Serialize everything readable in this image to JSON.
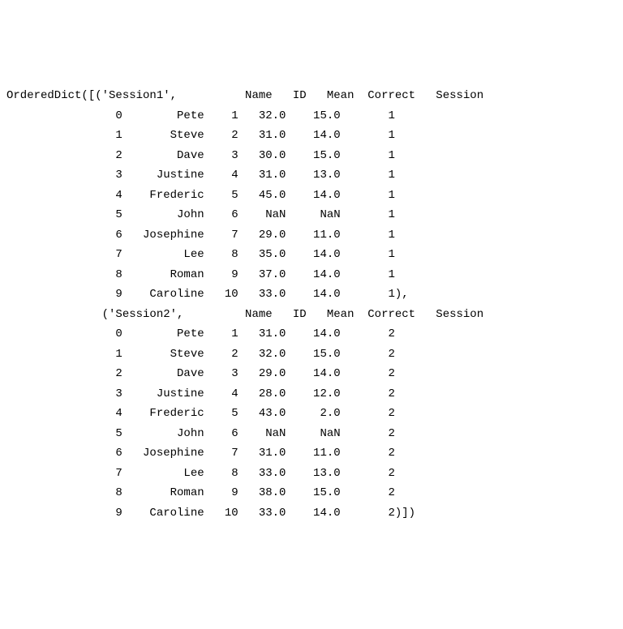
{
  "prefix": "OrderedDict([",
  "sessions": [
    {
      "key": "'Session1'",
      "columns": [
        "Name",
        "ID",
        "Mean",
        "Correct",
        "Session"
      ],
      "rows": [
        {
          "idx": "0",
          "name": "Pete",
          "id": "1",
          "mean": "32.0",
          "correct": "15.0",
          "session": "1"
        },
        {
          "idx": "1",
          "name": "Steve",
          "id": "2",
          "mean": "31.0",
          "correct": "14.0",
          "session": "1"
        },
        {
          "idx": "2",
          "name": "Dave",
          "id": "3",
          "mean": "30.0",
          "correct": "15.0",
          "session": "1"
        },
        {
          "idx": "3",
          "name": "Justine",
          "id": "4",
          "mean": "31.0",
          "correct": "13.0",
          "session": "1"
        },
        {
          "idx": "4",
          "name": "Frederic",
          "id": "5",
          "mean": "45.0",
          "correct": "14.0",
          "session": "1"
        },
        {
          "idx": "5",
          "name": "John",
          "id": "6",
          "mean": "NaN",
          "correct": "NaN",
          "session": "1"
        },
        {
          "idx": "6",
          "name": "Josephine",
          "id": "7",
          "mean": "29.0",
          "correct": "11.0",
          "session": "1"
        },
        {
          "idx": "7",
          "name": "Lee",
          "id": "8",
          "mean": "35.0",
          "correct": "14.0",
          "session": "1"
        },
        {
          "idx": "8",
          "name": "Roman",
          "id": "9",
          "mean": "37.0",
          "correct": "14.0",
          "session": "1"
        },
        {
          "idx": "9",
          "name": "Caroline",
          "id": "10",
          "mean": "33.0",
          "correct": "14.0",
          "session": "1"
        }
      ],
      "terminator": "),"
    },
    {
      "key": "'Session2'",
      "columns": [
        "Name",
        "ID",
        "Mean",
        "Correct",
        "Session"
      ],
      "rows": [
        {
          "idx": "0",
          "name": "Pete",
          "id": "1",
          "mean": "31.0",
          "correct": "14.0",
          "session": "2"
        },
        {
          "idx": "1",
          "name": "Steve",
          "id": "2",
          "mean": "32.0",
          "correct": "15.0",
          "session": "2"
        },
        {
          "idx": "2",
          "name": "Dave",
          "id": "3",
          "mean": "29.0",
          "correct": "14.0",
          "session": "2"
        },
        {
          "idx": "3",
          "name": "Justine",
          "id": "4",
          "mean": "28.0",
          "correct": "12.0",
          "session": "2"
        },
        {
          "idx": "4",
          "name": "Frederic",
          "id": "5",
          "mean": "43.0",
          "correct": "2.0",
          "session": "2"
        },
        {
          "idx": "5",
          "name": "John",
          "id": "6",
          "mean": "NaN",
          "correct": "NaN",
          "session": "2"
        },
        {
          "idx": "6",
          "name": "Josephine",
          "id": "7",
          "mean": "31.0",
          "correct": "11.0",
          "session": "2"
        },
        {
          "idx": "7",
          "name": "Lee",
          "id": "8",
          "mean": "33.0",
          "correct": "13.0",
          "session": "2"
        },
        {
          "idx": "8",
          "name": "Roman",
          "id": "9",
          "mean": "38.0",
          "correct": "15.0",
          "session": "2"
        },
        {
          "idx": "9",
          "name": "Caroline",
          "id": "10",
          "mean": "33.0",
          "correct": "14.0",
          "session": "2"
        }
      ],
      "terminator": ")])"
    }
  ]
}
